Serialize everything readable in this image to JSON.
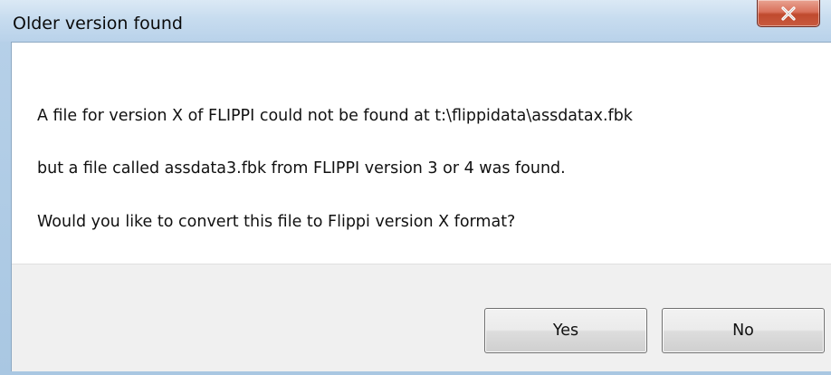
{
  "dialog": {
    "title": "Older version found",
    "close_icon": "close-icon",
    "message_lines": [
      "A file for version X of FLIPPI could not be found at t:\\flippidata\\assdatax.fbk",
      "but a file called assdata3.fbk from FLIPPI version 3 or 4 was found.",
      "Would you like to convert this file to Flippi version X format?"
    ],
    "buttons": {
      "yes_label": "Yes",
      "no_label": "No"
    }
  },
  "colors": {
    "close_button": "#c85a3f",
    "footer_background": "#f0f0f0"
  }
}
